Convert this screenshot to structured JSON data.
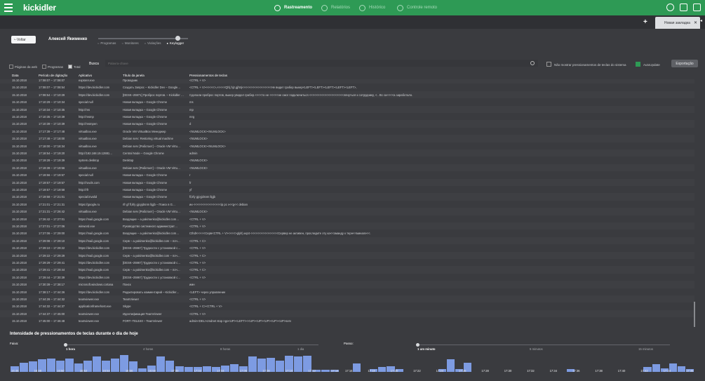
{
  "topbar": {
    "logo": "kickidler",
    "nav": [
      {
        "label": "Rastreamento",
        "active": true
      },
      {
        "label": "Relatórios",
        "active": false
      },
      {
        "label": "Histórico",
        "active": false
      },
      {
        "label": "Controle remoto",
        "active": false
      }
    ]
  },
  "tabs": {
    "active": "Новая закладка"
  },
  "header": {
    "back_label": "Voltar",
    "user": "Алексей Якименко",
    "modes": [
      "Programas",
      "Monitores",
      "Violações",
      "Keylogger"
    ],
    "filters": [
      "Páginas da web",
      "Programas",
      "Total"
    ],
    "search_label": "Busca",
    "search_placeholder": "Palavra-chave",
    "opt_hide": "Não mostrar pressionamentos de teclas do sistema",
    "opt_autoupdate": "AutoUpdate",
    "export_label": "Exportação"
  },
  "table": {
    "columns": [
      "Data",
      "Período de digitação",
      "Aplicativo",
      "Título da janela",
      "Pressionamentos de teclas"
    ],
    "rows": [
      [
        "15.10.2018",
        "17:08:07 – 17:08:07",
        "explorer.exe",
        "Проводник",
        "<CTRL + V>"
      ],
      [
        "15.10.2018",
        "17:08:07 – 17:08:54",
        "https://dev.kickidler.com",
        "Создать Запрос – Kickidler Dev – Google…",
        "<CTRL + V><<<<<>,<<<<<Qh),hjz.gjhtrj<<<<<<<<<<<<<<<<<Не видит грабер выкер<LEFT><LEFT><LEFT><LEFT><LEFT>,"
      ],
      [
        "15.10.2018",
        "17:08:54 – 17:10:29",
        "https://dev.kickidler.com",
        "[DESK–25971] Проброс портов. – Kickidler Dev – Google…",
        "Сделали проброс портов, выкер увидел грабер.<<<<то не <<<<<не смог подключиться <<<<<<<<<<<<<<<<<<<<лянуться к сотруднику, <.. Вс са<<<<а заработало."
      ],
      [
        "15.10.2018",
        "17:10:29 – 17:10:34",
        "special:null",
        "Новая вкладка – Google Chrome",
        "ms"
      ],
      [
        "15.10.2018",
        "17:10:34 – 17:10:35",
        "http://ms",
        "Новая вкладка – Google Chrome",
        "mp"
      ],
      [
        "15.10.2018",
        "17:10:35 – 17:10:39",
        "http://msmp",
        "Новая вкладка – Google Chrome",
        "mrg"
      ],
      [
        "15.10.2018",
        "17:10:39 – 17:10:39",
        "http://msmpen",
        "Новая вкладка – Google Chrome",
        "d"
      ],
      [
        "15.10.2018",
        "17:17:39 – 17:17:48",
        "virtualbox.exe",
        "Oracle VM VirtualBox Менеджер",
        "<NUMLOCK><NUMLOCK>"
      ],
      [
        "15.10.2018",
        "17:17:48 – 17:18:00",
        "virtualbox.exe",
        "Debian serv: Restoring virtual machine",
        "<NUMLOCK>"
      ],
      [
        "15.10.2018",
        "17:18:00 – 17:18:34",
        "virtualbox.exe",
        "Debian serv [Работает] – Oracle VM Virtu…",
        "<NUMLOCK><NUMLOCK>"
      ],
      [
        "15.10.2018",
        "17:18:54 – 17:19:20",
        "http://192.168.19.12881…",
        "Central Node – Google Chrome",
        "admin"
      ],
      [
        "15.10.2018",
        "17:19:28 – 17:19:39",
        "system.desktop",
        "Desktop",
        "<NUMLOCK>"
      ],
      [
        "15.10.2018",
        "17:19:39 – 17:19:56",
        "virtualbox.exe",
        "Debian serv [Работает] – Oracle VM Virtu…",
        "<NUMLOCK>"
      ],
      [
        "15.10.2018",
        "17:19:56 – 17:19:57",
        "special:null",
        "Новая вкладка – Google Chrome",
        "r"
      ],
      [
        "15.10.2018",
        "17:19:57 – 17:19:57",
        "http://ruvds.com",
        "Новая вкладка – Google Chrome",
        "fr"
      ],
      [
        "15.10.2018",
        "17:19:57 – 17:19:58",
        "http://rfr",
        "Новая вкладка – Google Chrome",
        "yf"
      ],
      [
        "15.10.2018",
        "17:19:58 – 17:21:01",
        "special:invalid",
        "Новая вкладка – Google Chrome",
        "fl,kfy gjcyjdsnm llgjb"
      ],
      [
        "15.10.2018",
        "17:21:01 – 17:21:31",
        "https://google.ru",
        "rfr gf fl,kfy gjcyjdsnm llgjb – Поиск в G…",
        "ии <<<<<<<<<<<<<<<<ip pc v<<g<< debian"
      ],
      [
        "15.10.2018",
        "17:21:31 – 17:26:42",
        "virtualbox.exe",
        "Debian serv [Работает] – Oracle VM Virtu…",
        "<NUMLOCK>"
      ],
      [
        "15.10.2018",
        "17:26:42 – 17:27:01",
        "https://mail.google.com",
        "Входящие – a.yakimenko@kickidler.com…",
        "<CTRL + V>"
      ],
      [
        "15.10.2018",
        "17:27:01 – 17:27:06",
        "winword.exe",
        "Руководство системного администрат…",
        "<CTRL + V>"
      ],
      [
        "15.10.2018",
        "17:27:06 – 17:29:00",
        "https://mail.google.com",
        "Входящие – a.yakimenko@kickidler.com…",
        "Cthdt<<<<<Серв<CTRL + V><<<<>glyh).eqnt <<<<<<<<<<<<<<<<Сервер не активен, проследите эту ка<<оманду к терн<<минале<<."
      ],
      [
        "15.10.2018",
        "17:29:08 – 17:29:10",
        "https://mail.google.com",
        "Серв – a.yakimenko@kickidler.com – поч…",
        "<CTRL + C>"
      ],
      [
        "15.10.2018",
        "17:29:10 – 17:29:22",
        "https://dev.kickidler.com",
        "[DESK–25967] Трудности с установкой с…",
        "<CTRL + V>"
      ],
      [
        "15.10.2018",
        "17:29:22 – 17:29:29",
        "https://mail.google.com",
        "Серв – a.yakimenko@kickidler.com – поч…",
        "<CTRL + C>"
      ],
      [
        "15.10.2018",
        "17:29:29 – 17:29:41",
        "https://dev.kickidler.com",
        "[DESK–25967] Трудности с установкой с…",
        "<CTRL + V>"
      ],
      [
        "15.10.2018",
        "17:29:41 – 17:29:44",
        "https://mail.google.com",
        "Серв – a.yakimenko@kickidler.com – поч…",
        "<CTRL + C>"
      ],
      [
        "15.10.2018",
        "17:29:44 – 17:30:39",
        "https://dev.kickidler.com",
        "[DESK–25967] Трудности с установкой с…",
        "<CTRL + V>"
      ],
      [
        "15.10.2018",
        "17:30:39 – 17:38:17",
        "microsoft.windows.cortana",
        "Поиск",
        "имн"
      ],
      [
        "15.10.2018",
        "17:38:17 – 17:44:26",
        "https://dev.kickidler.com",
        "Редактировать комментарий – Kickidler…",
        "<LEFT> через управление"
      ],
      [
        "15.10.2018",
        "17:44:26 – 17:44:32",
        "teamviewer.exe",
        "TeamViewer",
        "<CTRL + V>"
      ],
      [
        "15.10.2018",
        "17:44:32 – 17:44:37",
        "applicationframehost.exe",
        "Skype",
        "<CTRL + C><CTRL + V>"
      ],
      [
        "15.10.2018",
        "17:44:37 – 17:45:00",
        "teamviewer.exe",
        "Идентификация TeamViewer",
        "<CTRL + V>"
      ],
      [
        "15.10.2018",
        "17:45:00 – 17:46:48",
        "teamviewer.exe",
        "FORT–TELE40 – TeamViewer",
        "admin<DEL>cmdnet stop ngo<UP><LEFT><<UP><UP><UP><UP><UP>serv"
      ]
    ]
  },
  "chart": {
    "title": "Intensidade de pressionamentos de teclas durante o dia de hoje"
  },
  "chart_data": [
    {
      "type": "bar",
      "period_label": "Faixa:",
      "period_options": [
        "1 hora",
        "4 horas",
        "8 horas",
        "1 dia"
      ],
      "period_selected": "1 hora",
      "xticks": [
        "16:46",
        "16:48",
        "16:50",
        "16:52",
        "16:54",
        "16:56",
        "16:58",
        "17:00",
        "17:02",
        "17:04",
        "17:06",
        "17:08",
        "17:10",
        "17:12",
        "17:14"
      ],
      "values": [
        6,
        10,
        11,
        13,
        14,
        12,
        14,
        9,
        12,
        16,
        12,
        14,
        18,
        11,
        4,
        7,
        16,
        12,
        6,
        5,
        5,
        6,
        5,
        7,
        8,
        6,
        16,
        14,
        15,
        12,
        17,
        16,
        17,
        2,
        2,
        2
      ],
      "ylim": [
        0,
        20
      ],
      "color": "#7d9be2"
    },
    {
      "type": "bar",
      "period_label": "Passo:",
      "period_options": [
        "1 um minuto",
        "5 minutos",
        "15 minutos"
      ],
      "period_selected": "1 um minuto",
      "xticks": [
        "17:16",
        "17:18",
        "17:20",
        "17:22",
        "17:24",
        "17:26",
        "17:28",
        "17:30",
        "17:32",
        "17:34",
        "17:36",
        "17:38",
        "17:40",
        "17:42",
        "17:44",
        "17:46"
      ],
      "values": [
        0,
        9,
        0,
        3,
        5,
        6,
        3,
        0,
        0,
        0,
        0,
        3,
        13,
        3,
        10,
        0,
        0,
        0,
        0,
        0,
        0,
        0,
        0,
        0,
        0,
        0,
        3,
        0,
        0,
        0,
        0,
        0,
        0,
        0,
        0,
        5,
        8,
        4,
        9,
        6,
        3
      ],
      "ylim": [
        0,
        20
      ],
      "color": "#7d9be2"
    }
  ]
}
